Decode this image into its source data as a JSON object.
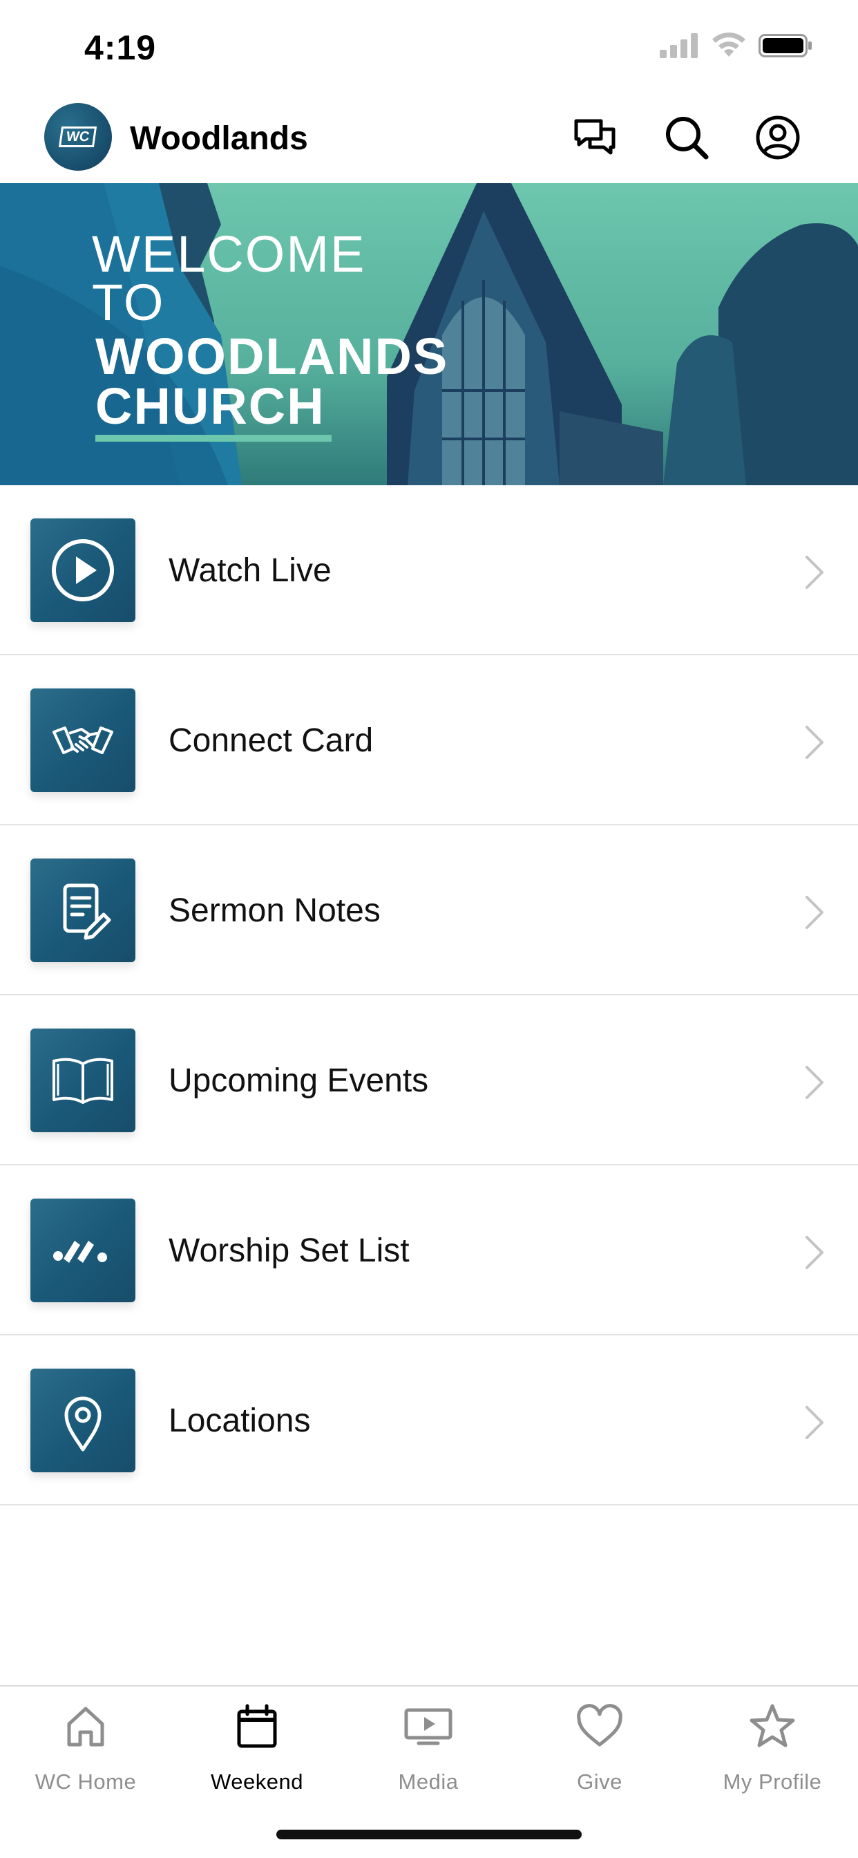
{
  "status_bar": {
    "time": "4:19"
  },
  "header": {
    "logo_text": "WC",
    "title": "Woodlands",
    "icons": [
      "chat-icon",
      "search-icon",
      "profile-icon"
    ]
  },
  "hero": {
    "line1": "WELCOME",
    "line2": "TO",
    "line3": "WOODLANDS",
    "line4": "CHURCH"
  },
  "menu": {
    "items": [
      {
        "label": "Watch Live",
        "icon": "play-icon"
      },
      {
        "label": "Connect Card",
        "icon": "handshake-icon"
      },
      {
        "label": "Sermon Notes",
        "icon": "notes-icon"
      },
      {
        "label": "Upcoming Events",
        "icon": "open-book-icon"
      },
      {
        "label": "Worship Set List",
        "icon": "worship-icon"
      },
      {
        "label": "Locations",
        "icon": "location-pin-icon"
      }
    ]
  },
  "tab_bar": {
    "tabs": [
      {
        "label": "WC Home",
        "icon": "home-icon",
        "active": false
      },
      {
        "label": "Weekend",
        "icon": "calendar-icon",
        "active": true
      },
      {
        "label": "Media",
        "icon": "media-icon",
        "active": false
      },
      {
        "label": "Give",
        "icon": "heart-icon",
        "active": false
      },
      {
        "label": "My Profile",
        "icon": "star-icon",
        "active": false
      }
    ]
  },
  "colors": {
    "brand_dark": "#174d6a",
    "brand_teal": "#6dc6ad",
    "tab_active": "#000000",
    "tab_inactive": "#8e8e8e"
  }
}
